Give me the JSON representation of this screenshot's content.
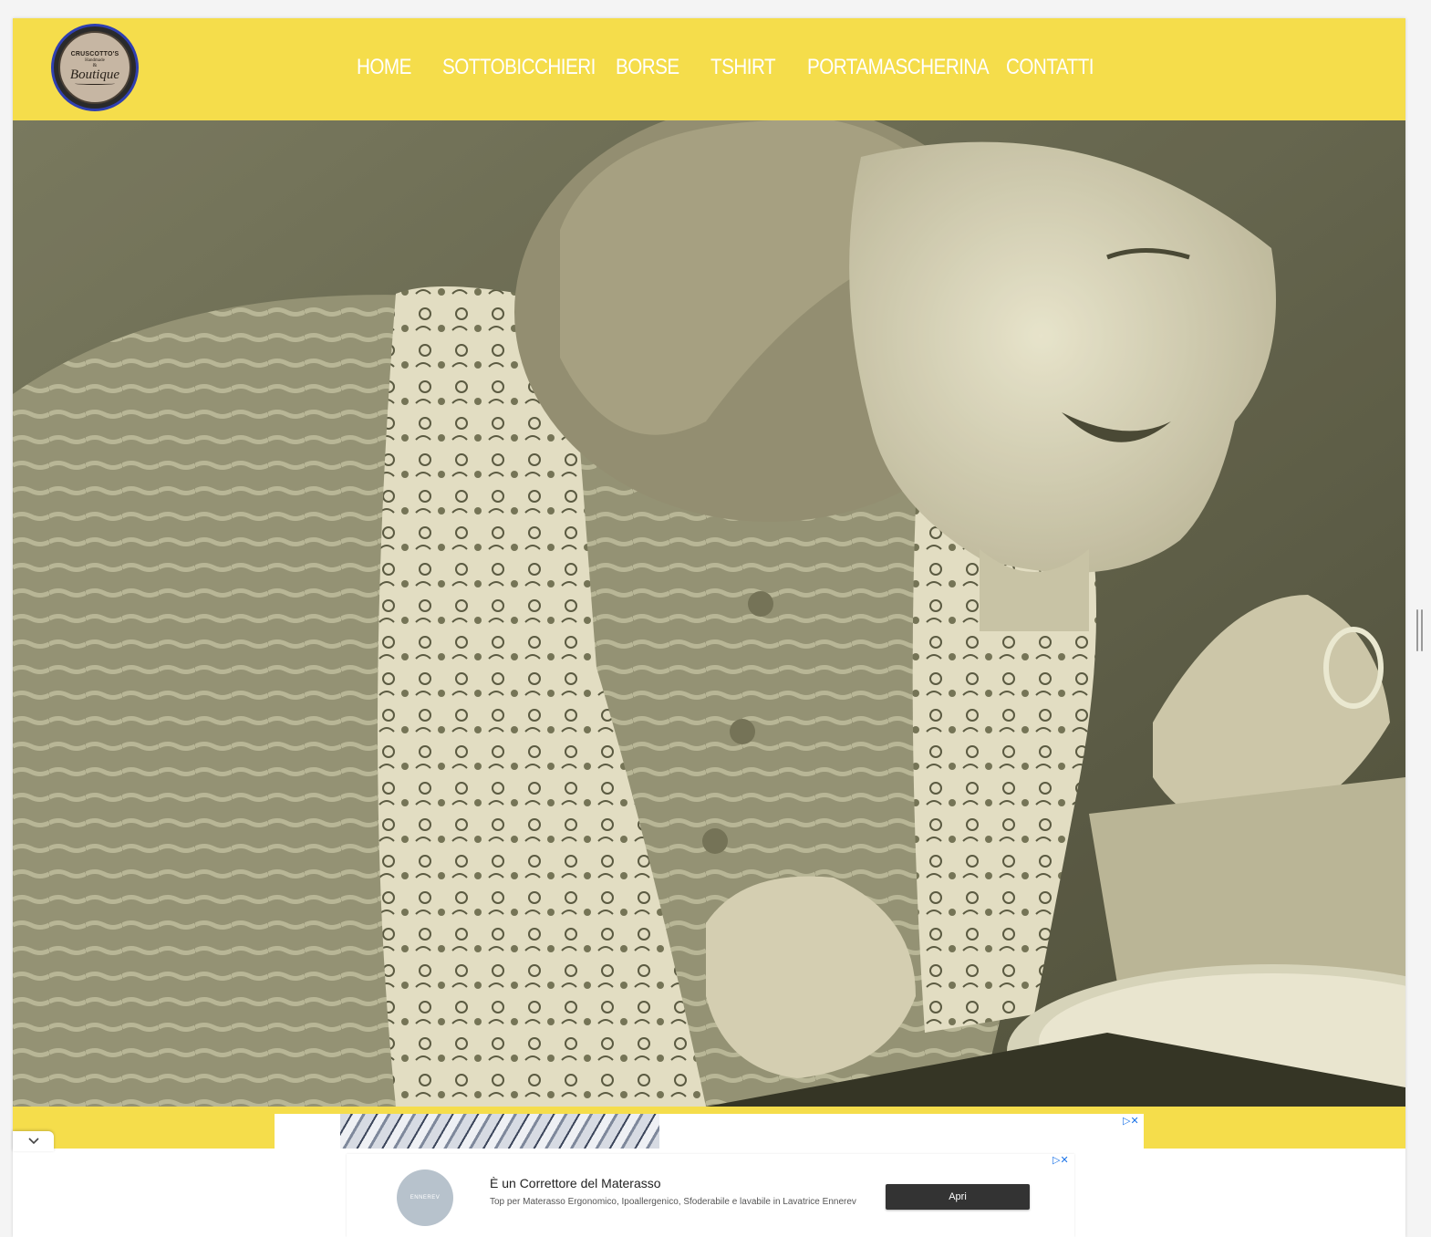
{
  "site": {
    "logo": {
      "line1": "CRUSCOTTO'S",
      "line2": "Handmade",
      "amp": "&",
      "line3": "Boutique"
    }
  },
  "nav": {
    "items": [
      {
        "label": "HOME"
      },
      {
        "label": "SOTTOBICCHIERI"
      },
      {
        "label": "BORSE"
      },
      {
        "label": "TSHIRT"
      },
      {
        "label": "PORTAMASCHERINA"
      },
      {
        "label": "CONTATTI"
      }
    ]
  },
  "hero": {
    "icon": "vintage-woman-photo"
  },
  "ads": {
    "ad_choices": "▷✕",
    "banner2": {
      "brand": "ENNEREV",
      "title": "È un Correttore del Materasso",
      "description": "Top per Materasso Ergonomico, Ipoallergenico, Sfoderabile e lavabile in Lavatrice Ennerev",
      "button": "Apri"
    }
  },
  "colors": {
    "accent": "#f5dd4b",
    "nav_text": "#ffffff",
    "logo_ring": "#2f3fb0"
  }
}
